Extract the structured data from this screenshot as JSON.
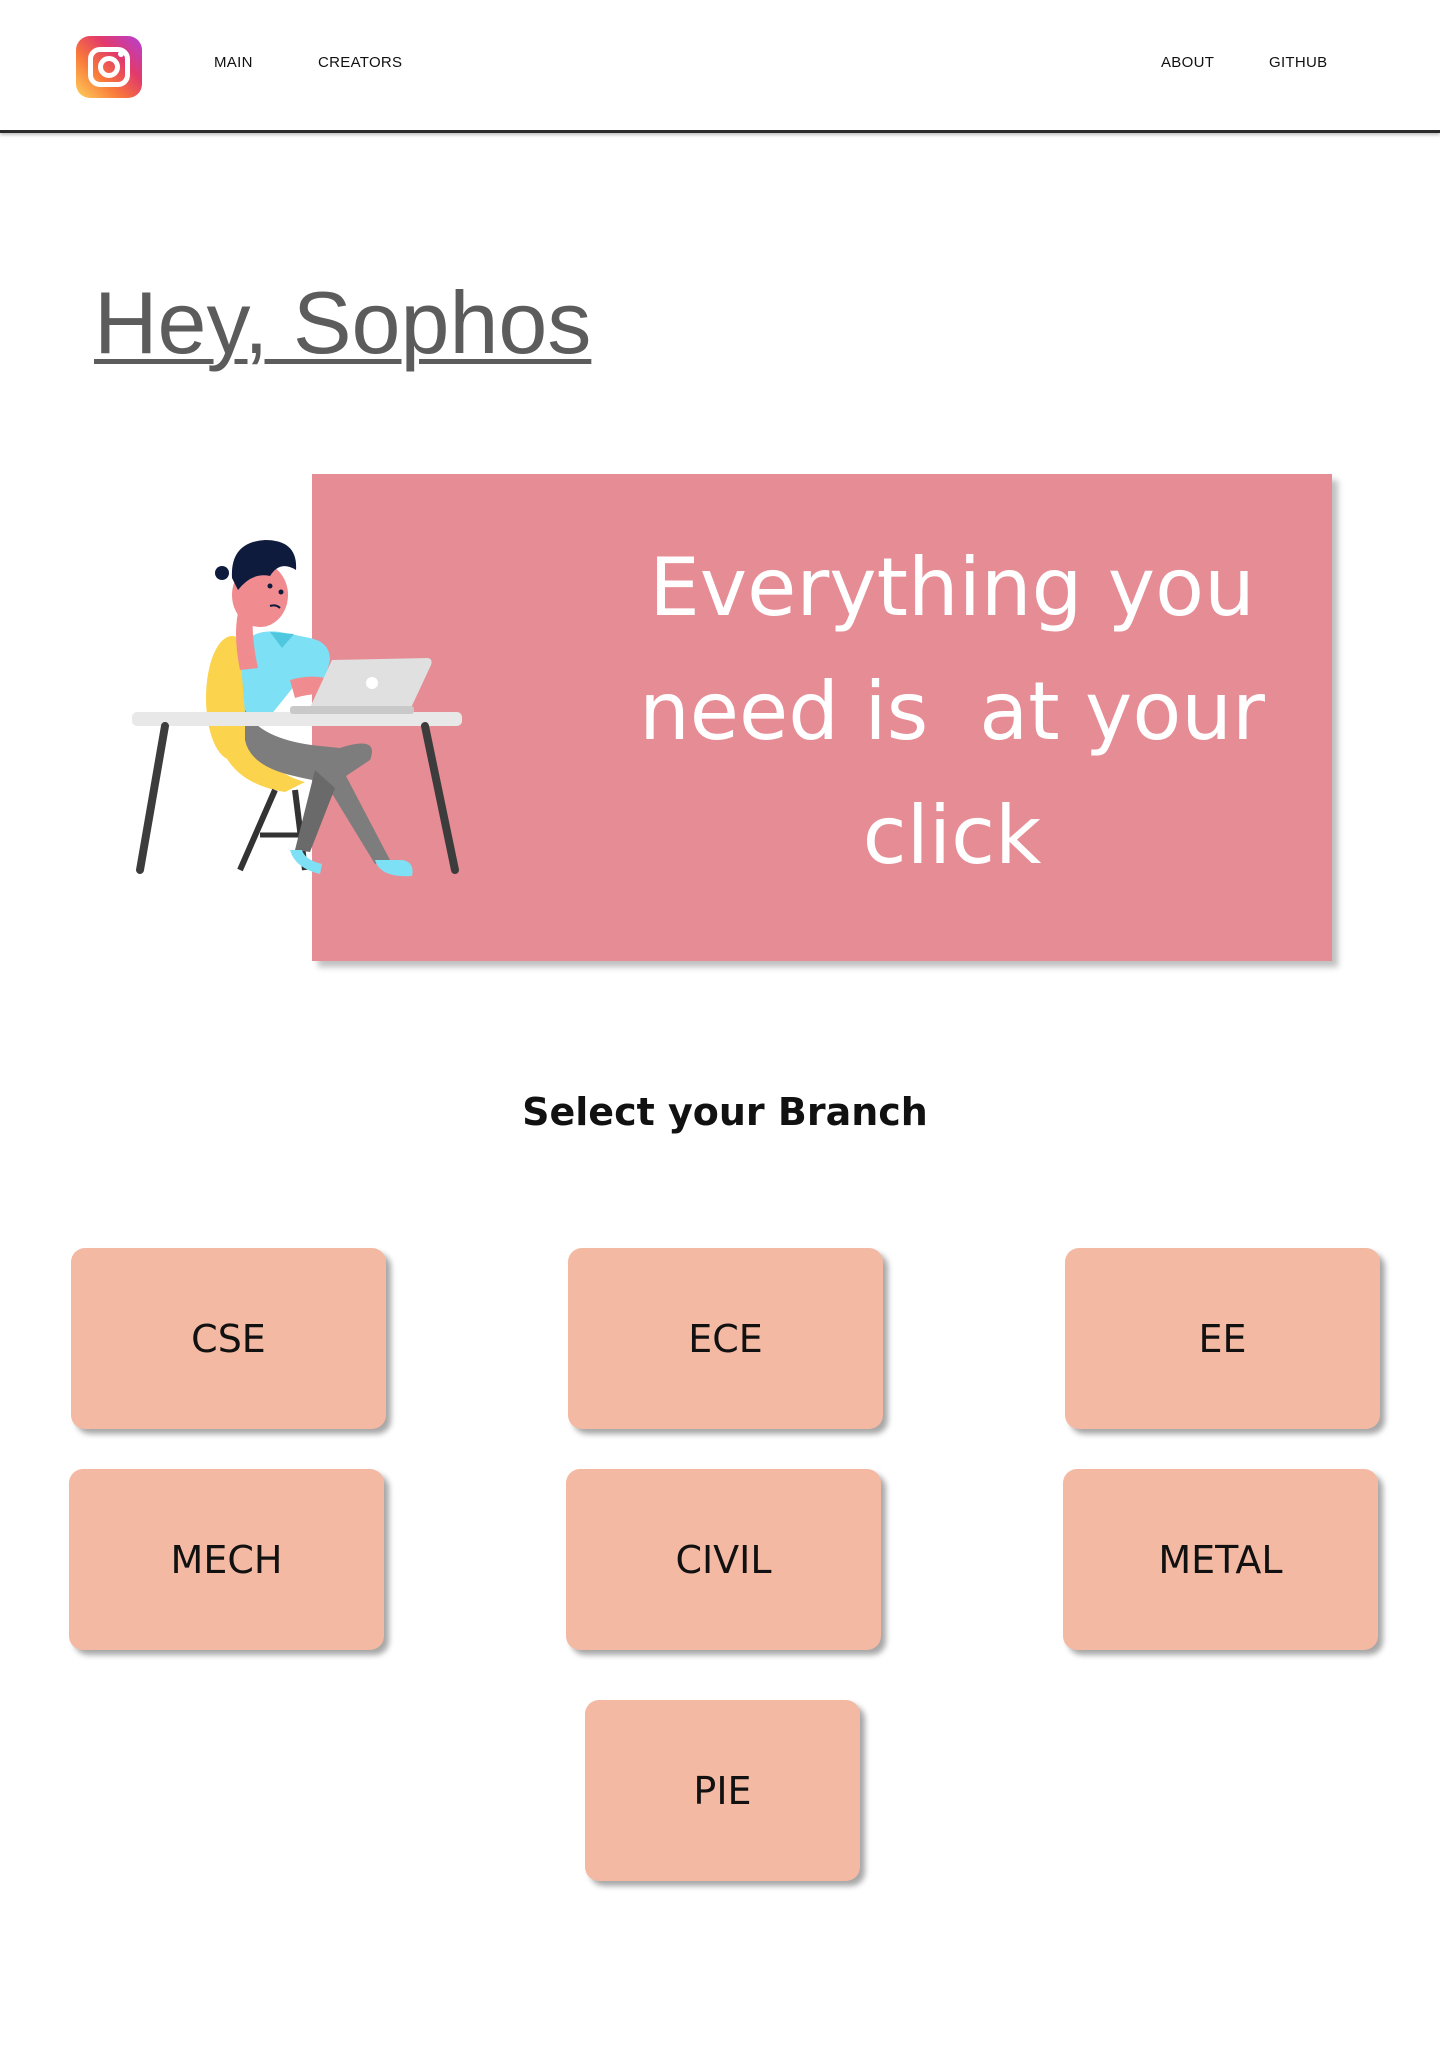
{
  "nav": {
    "logo_icon": "instagram-icon",
    "links": [
      "MAIN",
      "CREATORS",
      "ABOUT",
      "GITHUB"
    ]
  },
  "greeting": "Hey, Sophos",
  "hero": {
    "lines": [
      "Everything you",
      "need is  at your",
      "click"
    ],
    "background": "#e68c95"
  },
  "branch": {
    "title": "Select your Branch",
    "options": [
      "CSE",
      "ECE",
      "EE",
      "MECH",
      "CIVIL",
      "METAL",
      "PIE"
    ],
    "button_color": "#f3b9a3"
  }
}
